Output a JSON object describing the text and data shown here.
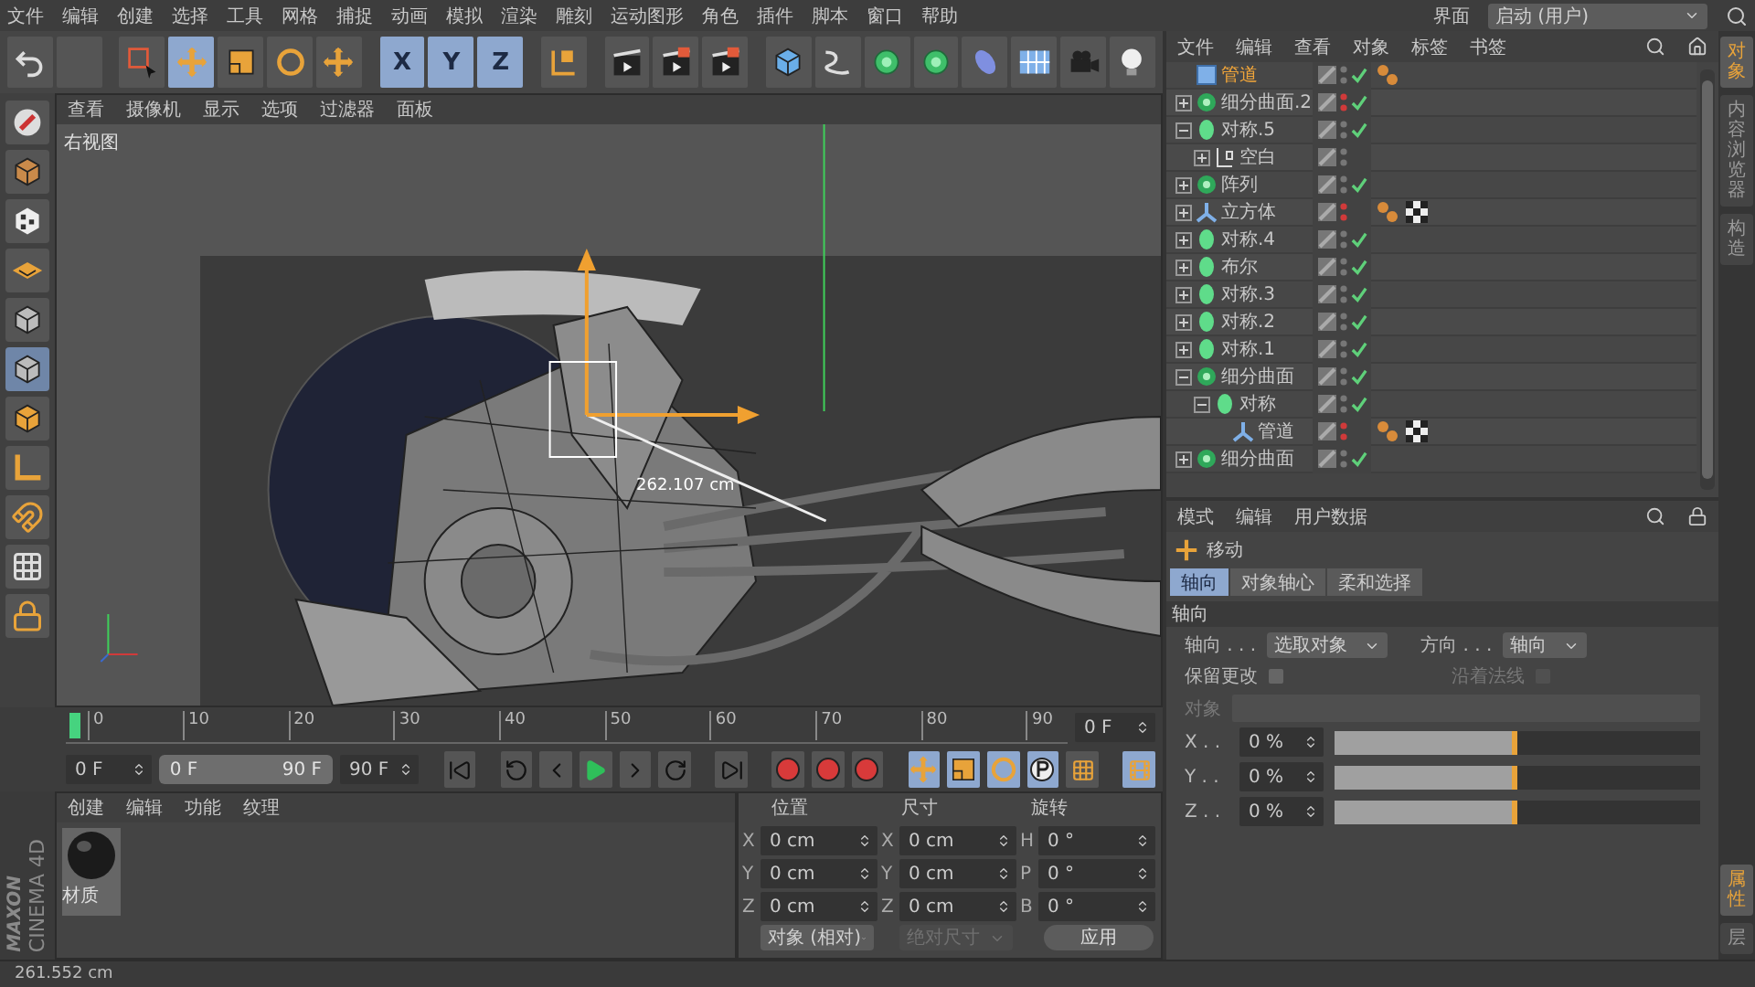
{
  "menu_bar": {
    "items": [
      "文件",
      "编辑",
      "创建",
      "选择",
      "工具",
      "网格",
      "捕捉",
      "动画",
      "模拟",
      "渲染",
      "雕刻",
      "运动图形",
      "角色",
      "插件",
      "脚本",
      "窗口",
      "帮助"
    ],
    "layout_label": "界面",
    "layout_value": "启动 (用户)"
  },
  "toolbar": {
    "tools": [
      {
        "kind": "undo",
        "selected": false
      },
      {
        "kind": "redo",
        "selected": false
      },
      {
        "kind": "select",
        "selected": false
      },
      {
        "kind": "move",
        "selected": true
      },
      {
        "kind": "scale",
        "selected": false
      },
      {
        "kind": "rotate",
        "selected": false
      },
      {
        "kind": "add",
        "selected": false
      },
      {
        "kind": "axis",
        "label": "X",
        "selected": true
      },
      {
        "kind": "axis",
        "label": "Y",
        "selected": true
      },
      {
        "kind": "axis",
        "label": "Z",
        "selected": true
      },
      {
        "kind": "coords",
        "selected": false
      },
      {
        "kind": "render-view",
        "selected": false
      },
      {
        "kind": "render-picture",
        "selected": false
      },
      {
        "kind": "render-settings",
        "selected": false
      },
      {
        "kind": "cube",
        "selected": false
      },
      {
        "kind": "pen",
        "selected": false
      },
      {
        "kind": "subdivision",
        "selected": false
      },
      {
        "kind": "array",
        "selected": false
      },
      {
        "kind": "deformer",
        "selected": false
      },
      {
        "kind": "floor",
        "selected": false
      },
      {
        "kind": "camera",
        "selected": false
      },
      {
        "kind": "light",
        "selected": false
      }
    ]
  },
  "left_toolbar": {
    "tools": [
      {
        "kind": "make-editable",
        "selected": false
      },
      {
        "kind": "model",
        "selected": false
      },
      {
        "kind": "texture",
        "selected": false
      },
      {
        "kind": "workplane",
        "selected": false
      },
      {
        "kind": "points",
        "selected": false
      },
      {
        "kind": "edges",
        "selected": true
      },
      {
        "kind": "polygons",
        "selected": false
      },
      {
        "kind": "axis-mode",
        "selected": false
      },
      {
        "kind": "magnet",
        "selected": false
      },
      {
        "kind": "snap",
        "selected": false
      },
      {
        "kind": "lock",
        "selected": false
      }
    ]
  },
  "viewport": {
    "menu": [
      "查看",
      "摄像机",
      "显示",
      "选项",
      "过滤器",
      "面板"
    ],
    "view_name": "右视图",
    "measurement": "262.107 cm"
  },
  "timeline": {
    "ticks": [
      "0",
      "10",
      "20",
      "30",
      "40",
      "50",
      "60",
      "70",
      "80",
      "90"
    ],
    "playhead": {
      "level": 0
    },
    "current_frame": "0 F"
  },
  "transport": {
    "start": "0 F",
    "range": {
      "start": "0 F",
      "end": "90 F",
      "level": 1
    },
    "end": "90 F"
  },
  "logo": {
    "brand": "MAXON",
    "product": "CINEMA 4D"
  },
  "material_manager": {
    "menu": [
      "创建",
      "编辑",
      "功能",
      "纹理"
    ],
    "materials": [
      {
        "name": "材质"
      }
    ]
  },
  "coordinates": {
    "headers": [
      "位置",
      "尺寸",
      "旋转"
    ],
    "rows": [
      {
        "labels": [
          "X",
          "X",
          "H"
        ],
        "values": [
          "0 cm",
          "0 cm",
          "0 °"
        ]
      },
      {
        "labels": [
          "Y",
          "Y",
          "P"
        ],
        "values": [
          "0 cm",
          "0 cm",
          "0 °"
        ]
      },
      {
        "labels": [
          "Z",
          "Z",
          "B"
        ],
        "values": [
          "0 cm",
          "0 cm",
          "0 °"
        ]
      }
    ],
    "mode": "对象 (相对)",
    "size_mode": "绝对尺寸",
    "apply": "应用"
  },
  "status_bar": {
    "text": "261.552 cm"
  },
  "object_manager": {
    "menu": [
      "文件",
      "编辑",
      "查看",
      "对象",
      "标签",
      "书签"
    ],
    "objects": [
      {
        "name": "管道",
        "kind": "pipe",
        "selected": true,
        "hidden": false,
        "enabled": true,
        "tags": [
          {
            "kind": "phong"
          }
        ]
      },
      {
        "name": "细分曲面.2",
        "kind": "subdivision",
        "selected": false,
        "expanded": false,
        "hidden": true,
        "enabled": true
      },
      {
        "name": "对称.5",
        "kind": "symmetry",
        "selected": false,
        "expanded": true,
        "hidden": false,
        "enabled": true,
        "children": [
          {
            "name": "空白",
            "kind": "null",
            "selected": false,
            "expanded": false,
            "hidden": false,
            "enabled": false
          }
        ]
      },
      {
        "name": "阵列",
        "kind": "array",
        "selected": false,
        "expanded": false,
        "hidden": false,
        "enabled": true
      },
      {
        "name": "立方体",
        "kind": "cube",
        "selected": false,
        "expanded": false,
        "hidden": true,
        "enabled": false,
        "tags": [
          {
            "kind": "phong"
          },
          {
            "kind": "texture"
          }
        ]
      },
      {
        "name": "对称.4",
        "kind": "symmetry",
        "selected": false,
        "expanded": false,
        "hidden": false,
        "enabled": true
      },
      {
        "name": "布尔",
        "kind": "boole",
        "selected": false,
        "expanded": false,
        "hidden": false,
        "enabled": true
      },
      {
        "name": "对称.3",
        "kind": "symmetry",
        "selected": false,
        "expanded": false,
        "hidden": false,
        "enabled": true
      },
      {
        "name": "对称.2",
        "kind": "symmetry",
        "selected": false,
        "expanded": false,
        "hidden": false,
        "enabled": true
      },
      {
        "name": "对称.1",
        "kind": "symmetry",
        "selected": false,
        "expanded": false,
        "hidden": false,
        "enabled": true
      },
      {
        "name": "细分曲面",
        "kind": "subdivision",
        "selected": false,
        "expanded": true,
        "hidden": false,
        "enabled": true,
        "children": [
          {
            "name": "对称",
            "kind": "symmetry",
            "selected": false,
            "expanded": true,
            "hidden": false,
            "enabled": true,
            "children": [
              {
                "name": "管道",
                "kind": "pipe-deformed",
                "selected": false,
                "hidden": true,
                "enabled": false,
                "tags": [
                  {
                    "kind": "phong"
                  },
                  {
                    "kind": "texture"
                  }
                ]
              }
            ]
          }
        ]
      },
      {
        "name": "细分曲面",
        "kind": "subdivision",
        "selected": false,
        "expanded": false,
        "hidden": false,
        "enabled": true
      }
    ]
  },
  "attributes": {
    "menu": [
      "模式",
      "编辑",
      "用户数据"
    ],
    "tool": "移动",
    "tabs": [
      {
        "label": "轴向",
        "selected": true
      },
      {
        "label": "对象轴心",
        "selected": false
      },
      {
        "label": "柔和选择",
        "selected": false
      }
    ],
    "section": "轴向",
    "axis_label": "轴向 . . .",
    "axis_value": "选取对象",
    "direction_label": "方向 . . .",
    "direction_value": "轴向",
    "checks": [
      {
        "label": "保留更改",
        "checked": false,
        "disabled": false
      },
      {
        "label": "沿着法线",
        "checked": false,
        "disabled": true
      }
    ],
    "object_label": "对象",
    "sliders": [
      {
        "label": "X . .",
        "value": "0 %",
        "level": 0.5
      },
      {
        "label": "Y . .",
        "value": "0 %",
        "level": 0.5
      },
      {
        "label": "Z . .",
        "value": "0 %",
        "level": 0.5
      }
    ]
  },
  "side_tabs": {
    "top": [
      {
        "label": "对象",
        "selected": true
      },
      {
        "label": "内容浏览器",
        "selected": false
      },
      {
        "label": "构造",
        "selected": false
      }
    ],
    "bottom": [
      {
        "label": "属性",
        "selected": true
      },
      {
        "label": "层",
        "selected": false
      }
    ]
  }
}
